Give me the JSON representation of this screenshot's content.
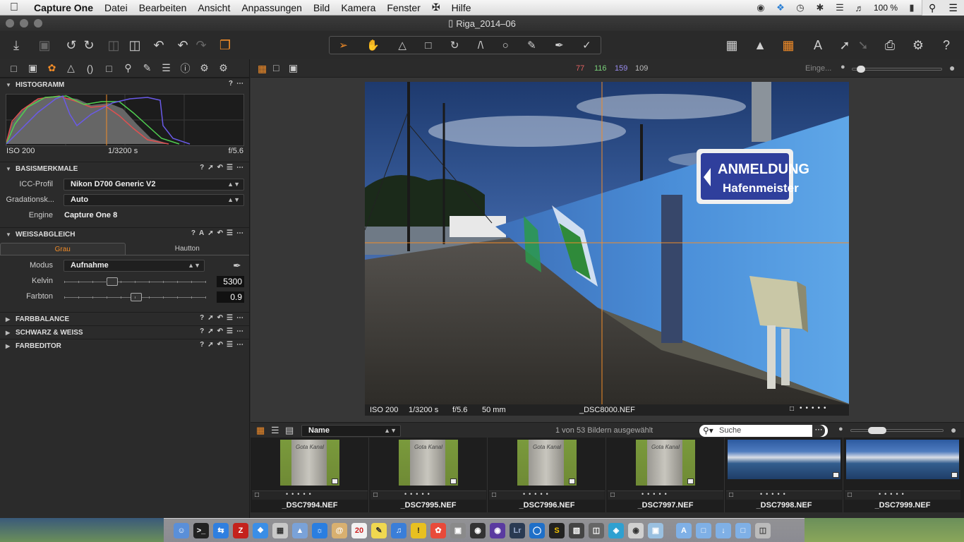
{
  "menubar": {
    "app_name": "Capture One",
    "items": [
      "Datei",
      "Bearbeiten",
      "Ansicht",
      "Anpassungen",
      "Bild",
      "Kamera",
      "Fenster",
      "Hilfe"
    ],
    "battery": "100 %"
  },
  "window": {
    "title": "Riga_2014–06"
  },
  "viewer_top": {
    "rgb": {
      "r": "77",
      "g": "116",
      "b": "159",
      "l": "109"
    },
    "zoom_label": "Einge..."
  },
  "panels": {
    "histogram": {
      "title": "HISTOGRAMM",
      "iso": "ISO 200",
      "shutter": "1/3200 s",
      "aperture": "f/5.6"
    },
    "basic": {
      "title": "BASISMERKMALE",
      "icc_label": "ICC-Profil",
      "icc_value": "Nikon D700 Generic V2",
      "curve_label": "Gradationsk...",
      "curve_value": "Auto",
      "engine_label": "Engine",
      "engine_value": "Capture One 8"
    },
    "white_balance": {
      "title": "WEISSABGLEICH",
      "tabs": [
        "Grau",
        "Hautton"
      ],
      "mode_label": "Modus",
      "mode_value": "Aufnahme",
      "kelvin_label": "Kelvin",
      "kelvin_value": "5300",
      "kelvin_position": 0.34,
      "tint_label": "Farbton",
      "tint_value": "0.9",
      "tint_position": 0.51
    },
    "collapsed": [
      "FARBBALANCE",
      "SCHWARZ & WEISS",
      "FARBEDITOR"
    ]
  },
  "photo_info": {
    "iso": "ISO 200",
    "shutter": "1/3200 s",
    "aperture": "f/5.6",
    "focal": "50 mm",
    "filename": "_DSC8000.NEF"
  },
  "photo_text": {
    "sign_line1": "ANMELDUNG",
    "sign_line2": "Hafenmeister"
  },
  "browser": {
    "sort_label": "Name",
    "count_text": "1 von 53 Bildern ausgewählt",
    "search_placeholder": "Suche",
    "thumbs": [
      {
        "name": "_DSC7994.NEF",
        "kind": "stone",
        "caption": "Gota Kanal"
      },
      {
        "name": "_DSC7995.NEF",
        "kind": "stone",
        "caption": "Gota Kanal"
      },
      {
        "name": "_DSC7996.NEF",
        "kind": "stone",
        "caption": "Gota Kanal"
      },
      {
        "name": "_DSC7997.NEF",
        "kind": "stone",
        "caption": "Gota Kanal"
      },
      {
        "name": "_DSC7998.NEF",
        "kind": "harbor",
        "caption": ""
      },
      {
        "name": "_DSC7999.NEF",
        "kind": "harbor",
        "caption": ""
      }
    ]
  },
  "dock": {
    "calendar_day": "20"
  },
  "colors": {
    "accent": "#f28c28",
    "r": "#e06060",
    "g": "#7ad27a",
    "b": "#9a8cf0"
  }
}
